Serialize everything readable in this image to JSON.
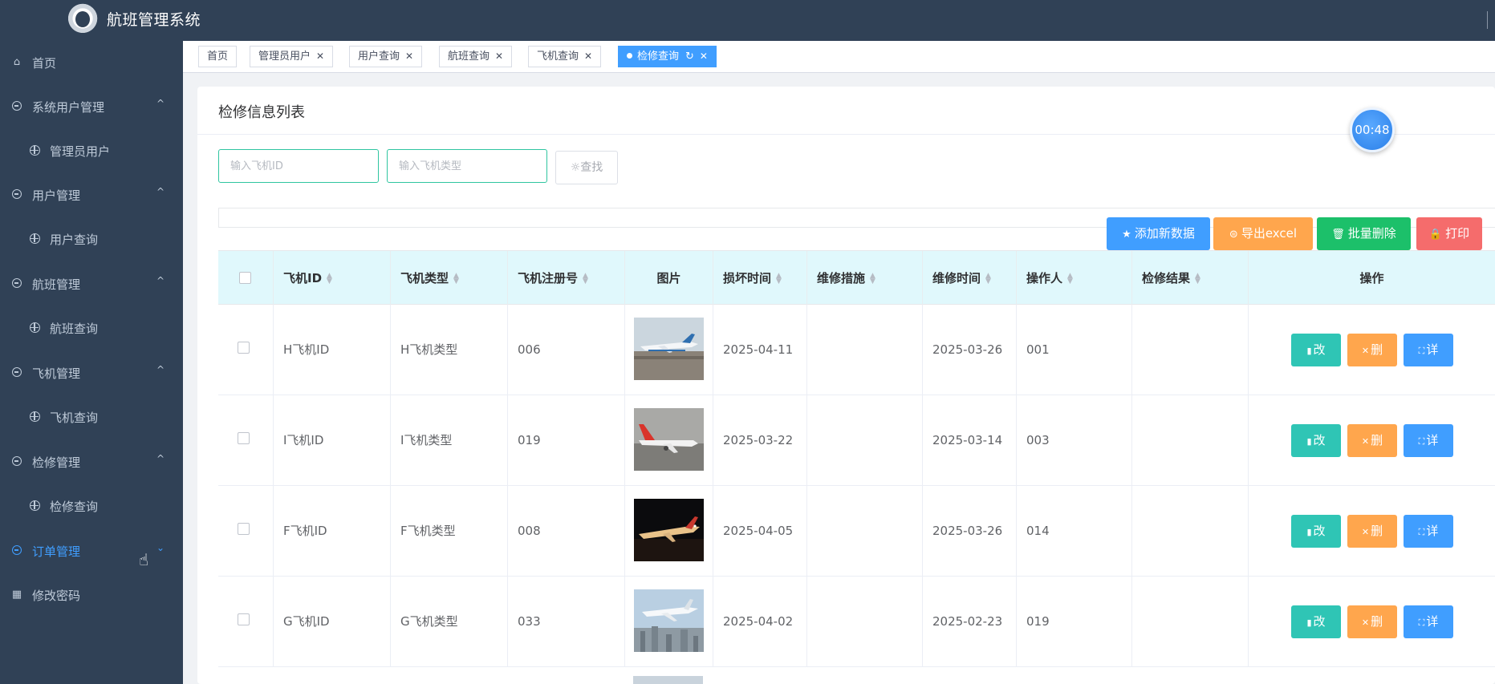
{
  "app": {
    "title": "航班管理系统"
  },
  "sidebar": {
    "items": [
      {
        "label": "首页",
        "icon": "home-icon",
        "level": 0,
        "expanded": null,
        "active": false
      },
      {
        "label": "系统用户管理",
        "icon": "circle-icon",
        "level": 0,
        "expanded": true,
        "active": false
      },
      {
        "label": "管理员用户",
        "icon": "target-icon",
        "level": 1,
        "expanded": null,
        "active": false
      },
      {
        "label": "用户管理",
        "icon": "circle-icon",
        "level": 0,
        "expanded": true,
        "active": false
      },
      {
        "label": "用户查询",
        "icon": "target-icon",
        "level": 1,
        "expanded": null,
        "active": false
      },
      {
        "label": "航班管理",
        "icon": "circle-icon",
        "level": 0,
        "expanded": true,
        "active": false
      },
      {
        "label": "航班查询",
        "icon": "target-icon",
        "level": 1,
        "expanded": null,
        "active": false
      },
      {
        "label": "飞机管理",
        "icon": "circle-icon",
        "level": 0,
        "expanded": true,
        "active": false
      },
      {
        "label": "飞机查询",
        "icon": "target-icon",
        "level": 1,
        "expanded": null,
        "active": false
      },
      {
        "label": "检修管理",
        "icon": "circle-icon",
        "level": 0,
        "expanded": true,
        "active": false
      },
      {
        "label": "检修查询",
        "icon": "target-icon",
        "level": 1,
        "expanded": null,
        "active": false
      },
      {
        "label": "订单管理",
        "icon": "circle-icon",
        "level": 0,
        "expanded": false,
        "active": true
      },
      {
        "label": "修改密码",
        "icon": "grid-icon",
        "level": 0,
        "expanded": null,
        "active": false
      }
    ]
  },
  "tabs": [
    {
      "label": "首页",
      "closable": false,
      "active": false
    },
    {
      "label": "管理员用户",
      "closable": true,
      "active": false
    },
    {
      "label": "用户查询",
      "closable": true,
      "active": false
    },
    {
      "label": "航班查询",
      "closable": true,
      "active": false
    },
    {
      "label": "飞机查询",
      "closable": true,
      "active": false
    },
    {
      "label": "检修查询",
      "closable": true,
      "active": true
    }
  ],
  "page": {
    "title": "检修信息列表",
    "timer": "00:48"
  },
  "search": {
    "aircraft_id_placeholder": "输入飞机ID",
    "aircraft_type_placeholder": "输入飞机类型",
    "button_label": "查找"
  },
  "toolbar": {
    "add_label": "添加新数据",
    "export_label": "导出excel",
    "batch_delete_label": "批量删除",
    "print_label": "打印"
  },
  "table": {
    "columns": [
      "飞机ID",
      "飞机类型",
      "飞机注册号",
      "图片",
      "损坏时间",
      "维修措施",
      "维修时间",
      "操作人",
      "检修结果",
      "操作"
    ],
    "rows": [
      {
        "aircraft_id": "H飞机ID",
        "aircraft_type": "H飞机类型",
        "registration": "006",
        "image": "plane-on-runway-day",
        "damage_time": "2025-04-11",
        "repair_measure": "",
        "repair_time": "2025-03-26",
        "operator": "001",
        "result": ""
      },
      {
        "aircraft_id": "I飞机ID",
        "aircraft_type": "I飞机类型",
        "registration": "019",
        "image": "red-tail-plane-taxiing",
        "damage_time": "2025-03-22",
        "repair_measure": "",
        "repair_time": "2025-03-14",
        "operator": "003",
        "result": ""
      },
      {
        "aircraft_id": "F飞机ID",
        "aircraft_type": "F飞机类型",
        "registration": "008",
        "image": "business-jet-at-night",
        "damage_time": "2025-04-05",
        "repair_measure": "",
        "repair_time": "2025-03-26",
        "operator": "014",
        "result": ""
      },
      {
        "aircraft_id": "G飞机ID",
        "aircraft_type": "G飞机类型",
        "registration": "033",
        "image": "jet-over-city",
        "damage_time": "2025-04-02",
        "repair_measure": "",
        "repair_time": "2025-02-23",
        "operator": "019",
        "result": ""
      }
    ],
    "row_actions": {
      "edit_label": "改",
      "delete_label": "删",
      "detail_label": "详"
    }
  },
  "colors": {
    "sidebar_bg": "#304156",
    "sidebar_text": "#bfcbd9",
    "active_blue": "#409eff",
    "teal": "#2fc5b5",
    "orange": "#ffa64d",
    "green": "#1cc06a",
    "red": "#f56c6c",
    "header_row_bg": "#e0f8fc"
  }
}
